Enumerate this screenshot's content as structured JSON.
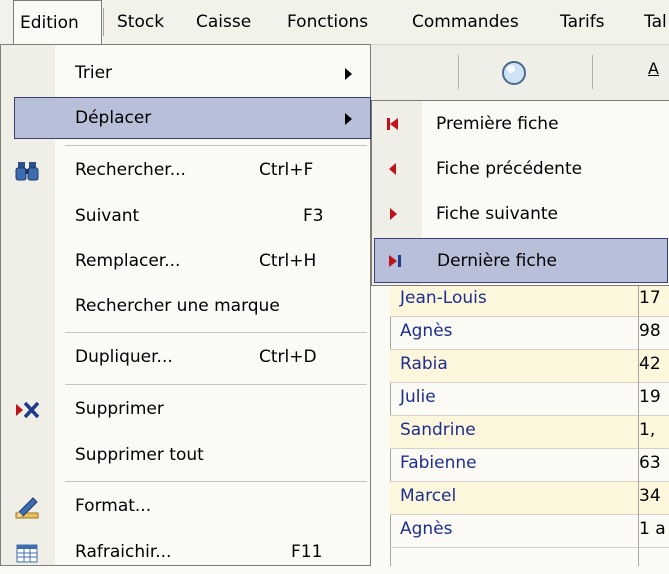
{
  "menubar": {
    "items": [
      {
        "label": "Edition"
      },
      {
        "label": "Stock"
      },
      {
        "label": "Caisse"
      },
      {
        "label": "Fonctions"
      },
      {
        "label": "Commandes"
      },
      {
        "label": "Tarifs"
      },
      {
        "label": "Tal"
      }
    ]
  },
  "menu": {
    "items": [
      {
        "label": "Trier",
        "shortcut": "",
        "icon": "none",
        "submenu": true
      },
      {
        "label": "Déplacer",
        "shortcut": "",
        "icon": "none",
        "submenu": true,
        "highlighted": true
      },
      {
        "label": "Rechercher...",
        "shortcut": "Ctrl+F",
        "icon": "binoculars-icon"
      },
      {
        "label": "Suivant",
        "shortcut": "F3",
        "icon": "none"
      },
      {
        "label": "Remplacer...",
        "shortcut": "Ctrl+H",
        "icon": "none"
      },
      {
        "label": "Rechercher une marque",
        "shortcut": "",
        "icon": "none"
      },
      {
        "label": "Dupliquer...",
        "shortcut": "Ctrl+D",
        "icon": "none"
      },
      {
        "label": "Supprimer",
        "shortcut": "",
        "icon": "delete-x-icon"
      },
      {
        "label": "Supprimer tout",
        "shortcut": "",
        "icon": "none"
      },
      {
        "label": "Format...",
        "shortcut": "",
        "icon": "format-pencil-icon"
      },
      {
        "label": "Rafraichir...",
        "shortcut": "F11",
        "icon": "table-refresh-icon"
      }
    ]
  },
  "submenu": {
    "items": [
      {
        "label": "Première fiche",
        "icon": "first-record-icon"
      },
      {
        "label": "Fiche précédente",
        "icon": "previous-record-icon"
      },
      {
        "label": "Fiche suivante",
        "icon": "next-record-icon"
      },
      {
        "label": "Dernière fiche",
        "icon": "last-record-icon",
        "highlighted": true
      }
    ]
  },
  "toolbar": {
    "underline_letter": "A"
  },
  "grid": {
    "rows": [
      {
        "name": "Jean-Louis",
        "value": "17"
      },
      {
        "name": "Agnès",
        "value": "98"
      },
      {
        "name": "Rabia",
        "value": "42"
      },
      {
        "name": "Julie",
        "value": "19"
      },
      {
        "name": "Sandrine",
        "value": "1,"
      },
      {
        "name": "Fabienne",
        "value": "63"
      },
      {
        "name": "Marcel",
        "value": "34"
      },
      {
        "name": "Agnès",
        "value": "1 a"
      }
    ]
  },
  "colors": {
    "highlight": "#b8bfd9",
    "highlight_border": "#3a3f7a",
    "name_text": "#1d2e8f",
    "row_alt": "#fcf7dc",
    "nav_red": "#c0121a"
  }
}
